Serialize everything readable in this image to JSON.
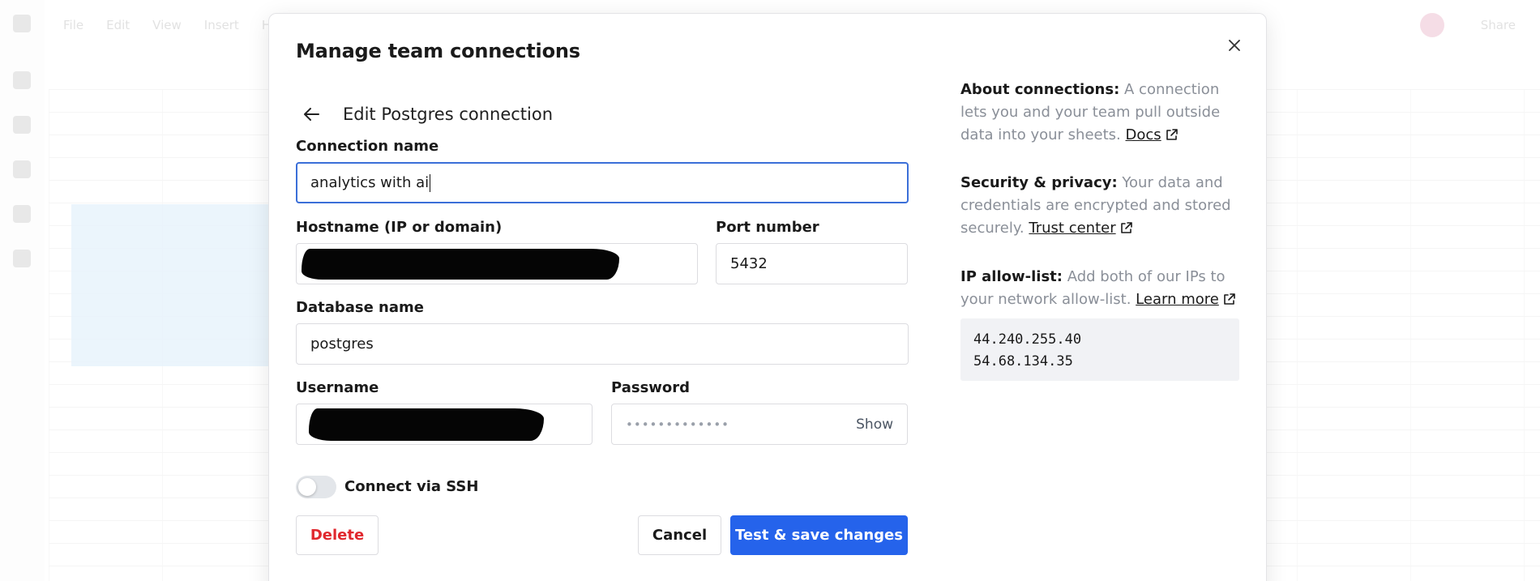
{
  "background_app": {
    "menu": [
      "File",
      "Edit",
      "View",
      "Insert",
      "Help"
    ],
    "share_label": "Share"
  },
  "dialog": {
    "title": "Manage team connections",
    "subtitle": "Edit Postgres connection",
    "fields": {
      "connection_name": {
        "label": "Connection name",
        "value": "analytics with ai"
      },
      "hostname": {
        "label": "Hostname (IP or domain)",
        "value": ""
      },
      "port": {
        "label": "Port number",
        "value": "5432"
      },
      "database": {
        "label": "Database name",
        "value": "postgres"
      },
      "username": {
        "label": "Username",
        "value": ""
      },
      "password": {
        "label": "Password",
        "value": "•••••••••••••",
        "show_label": "Show"
      }
    },
    "ssh_toggle": {
      "label": "Connect via SSH",
      "enabled": false
    },
    "buttons": {
      "delete": "Delete",
      "cancel": "Cancel",
      "save": "Test & save changes"
    },
    "info": {
      "about": {
        "title": "About connections:",
        "text": "A connection lets you and your team pull outside data into your sheets.",
        "link": "Docs"
      },
      "security": {
        "title": "Security & privacy:",
        "text": "Your data and credentials are encrypted and stored securely.",
        "link": "Trust center"
      },
      "ip_allow": {
        "title": "IP allow-list:",
        "text": "Add both of our IPs to your network allow-list.",
        "link": "Learn more"
      },
      "ips": [
        "44.240.255.40",
        "54.68.134.35"
      ]
    }
  },
  "colors": {
    "primary": "#2563eb",
    "danger": "#e0282e",
    "focus_border": "#3b6fd8"
  },
  "icons": [
    "close-icon",
    "arrow-left-icon",
    "external-link-icon"
  ]
}
